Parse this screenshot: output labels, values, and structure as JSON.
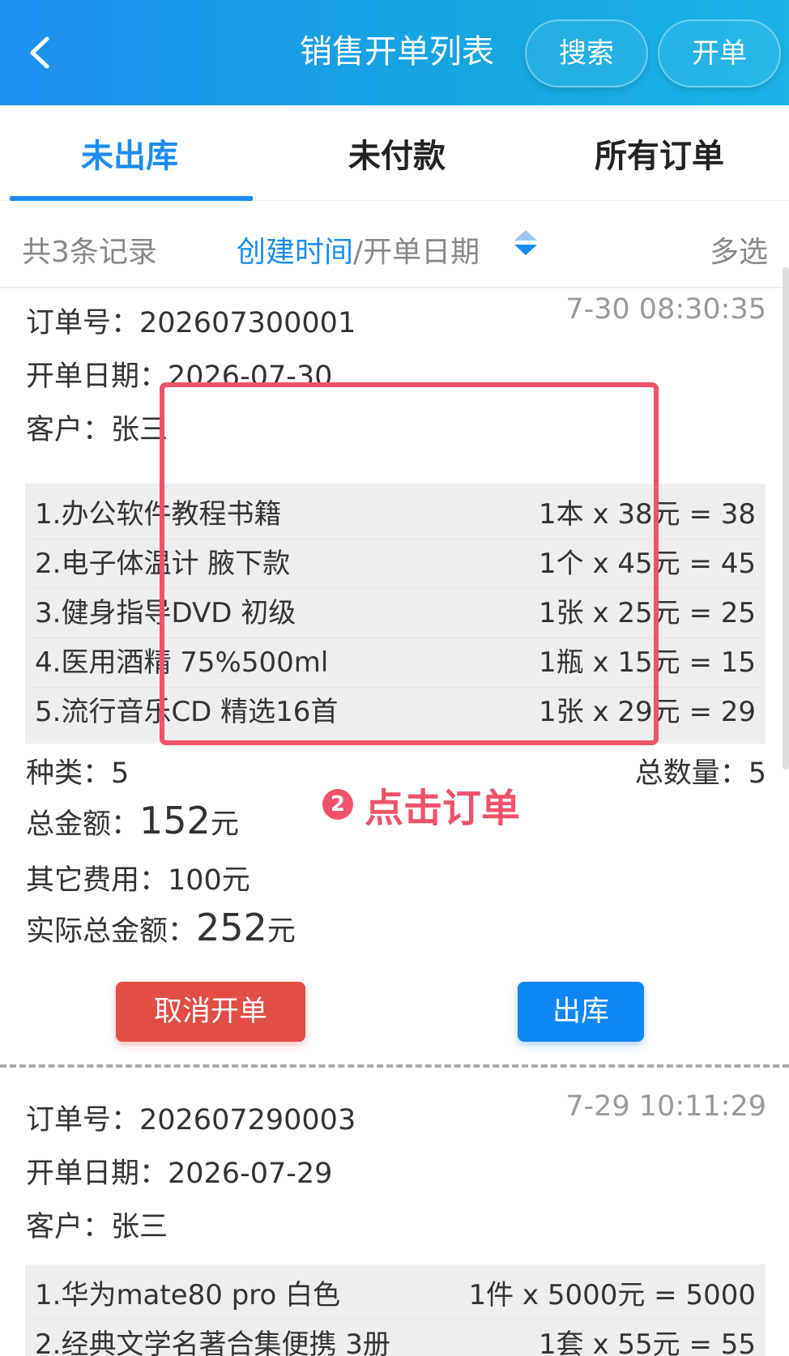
{
  "header": {
    "title": "销售开单列表",
    "search_label": "搜索",
    "create_label": "开单"
  },
  "tabs": [
    {
      "label": "未出库",
      "active": true
    },
    {
      "label": "未付款",
      "active": false
    },
    {
      "label": "所有订单",
      "active": false
    }
  ],
  "filter": {
    "count_text": "共3条记录",
    "sort_active": "创建时间",
    "sort_rest": "/开单日期",
    "multi_label": "多选"
  },
  "orders": [
    {
      "order_no_text": "订单号：202607300001",
      "time": "7-30 08:30:35",
      "date_text": "开单日期：2026-07-30",
      "customer_text": "客户：张三",
      "items": [
        {
          "name": "1.办公软件教程书籍",
          "qty": "1本 x 38元 = 38"
        },
        {
          "name": "2.电子体温计 腋下款",
          "qty": "1个 x 45元 = 45"
        },
        {
          "name": "3.健身指导DVD 初级",
          "qty": "1张 x 25元 = 25"
        },
        {
          "name": "4.医用酒精 75%500ml",
          "qty": "1瓶 x 15元 = 15"
        },
        {
          "name": "5.流行音乐CD 精选16首",
          "qty": "1张 x 29元 = 29"
        }
      ],
      "kinds_text": "种类：5",
      "total_qty_text": "总数量：5",
      "total_amount_label": "总金额：",
      "total_amount_value": "152",
      "total_amount_unit": "元",
      "other_fee_text": "其它费用：100元",
      "actual_total_label": "实际总金额：",
      "actual_total_value": "252",
      "actual_total_unit": "元",
      "cancel_label": "取消开单",
      "ship_label": "出库"
    },
    {
      "order_no_text": "订单号：202607290003",
      "time": "7-29 10:11:29",
      "date_text": "开单日期：2026-07-29",
      "customer_text": "客户：张三",
      "items": [
        {
          "name": "1.华为mate80 pro 白色",
          "qty": "1件 x 5000元 = 5000"
        },
        {
          "name": "2.经典文学名著合集便携 3册",
          "qty": "1套 x 55元 = 55"
        }
      ]
    }
  ],
  "annotation": {
    "number": "2",
    "text": "点击订单",
    "color": "#f0526a"
  },
  "colors": {
    "accent": "#1a8cf2",
    "cancel": "#e24d44",
    "ship": "#0f86f5"
  }
}
